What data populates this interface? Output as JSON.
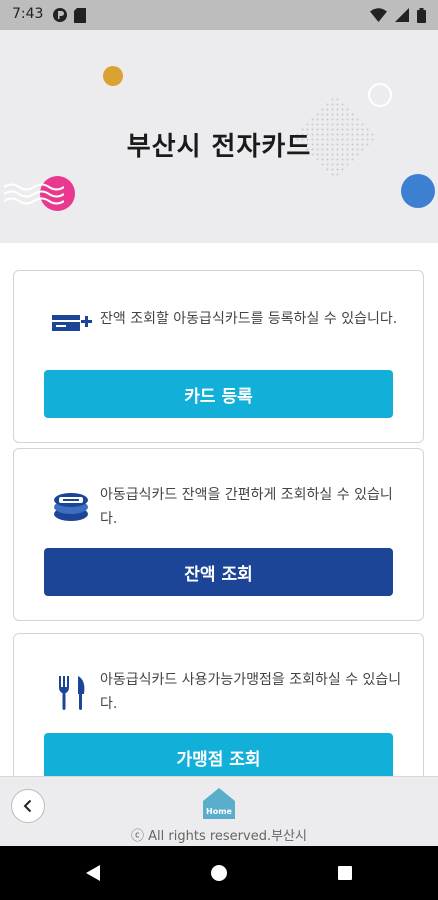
{
  "status_bar": {
    "time": "7:43",
    "left_icons": [
      "data-saver-icon",
      "sd-card-icon"
    ],
    "right_icons": [
      "wifi-icon",
      "signal-icon",
      "battery-icon"
    ]
  },
  "banner": {
    "title": "부산시 전자카드",
    "colors": {
      "background": "#ececee",
      "pink": "#e8388f",
      "blue": "#3d7fd0",
      "gold": "#d9a233"
    }
  },
  "cards": [
    {
      "icon": "card-register-icon",
      "description": "잔액 조회할 아동급식카드를 등록하실 수 있습니다.",
      "button_label": "카드 등록",
      "button_color": "#12afd9"
    },
    {
      "icon": "balance-wallet-icon",
      "description": "아동급식카드 잔액을 간편하게 조회하실 수 있습니다.",
      "button_label": "잔액 조회",
      "button_color": "#1c4598"
    },
    {
      "icon": "fork-knife-icon",
      "description": "아동급식카드 사용가능가맹점을 조회하실 수 있습니다.",
      "button_label": "가맹점 조회",
      "button_color": "#12afd9"
    }
  ],
  "footer": {
    "back_icon": "chevron-left-icon",
    "home_label": "Home",
    "copyright": "ⓒ All rights reserved.부산시"
  },
  "nav_bar": {
    "icons": [
      "back-triangle-icon",
      "home-circle-icon",
      "recents-square-icon"
    ]
  }
}
